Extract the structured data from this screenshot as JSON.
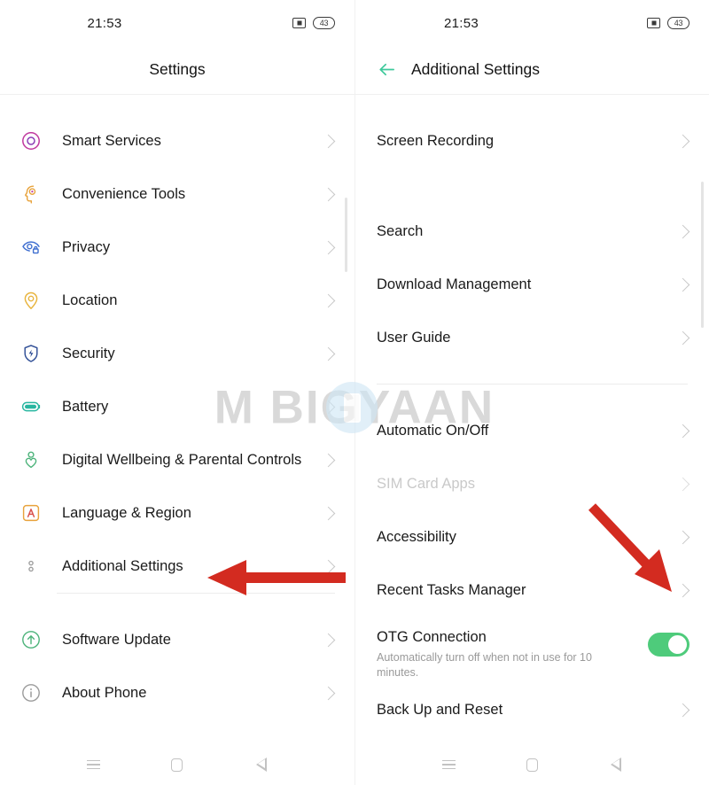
{
  "status": {
    "time": "21:53",
    "battery_level": "43",
    "cast_icon": "cast-icon",
    "battery_icon": "battery-icon"
  },
  "left_panel": {
    "title": "Settings",
    "items": [
      {
        "label": "Smart Services",
        "icon": "smart-services-icon",
        "color": "#c0399f"
      },
      {
        "label": "Convenience Tools",
        "icon": "convenience-tools-icon",
        "color": "#e8a33d"
      },
      {
        "label": "Privacy",
        "icon": "privacy-icon",
        "color": "#3f6fd0"
      },
      {
        "label": "Location",
        "icon": "location-icon",
        "color": "#e8b43d"
      },
      {
        "label": "Security",
        "icon": "security-icon",
        "color": "#2f4e96"
      },
      {
        "label": "Battery",
        "icon": "battery-settings-icon",
        "color": "#27b6a0"
      },
      {
        "label": "Digital Wellbeing & Parental Controls",
        "icon": "digital-wellbeing-icon",
        "color": "#4cb37a"
      },
      {
        "label": "Language & Region",
        "icon": "language-region-icon",
        "color": "#e8a33d"
      },
      {
        "label": "Additional Settings",
        "icon": "additional-settings-icon",
        "color": "#9b9b9b"
      },
      {
        "label": "Software Update",
        "icon": "software-update-icon",
        "color": "#4cb37a"
      },
      {
        "label": "About Phone",
        "icon": "about-phone-icon",
        "color": "#9b9b9b"
      }
    ]
  },
  "right_panel": {
    "title": "Additional Settings",
    "back_icon": "back-arrow-icon",
    "back_icon_color": "#3ec99b",
    "items": [
      {
        "label": "Screen Recording",
        "type": "link"
      },
      {
        "label": "Search",
        "type": "link"
      },
      {
        "label": "Download Management",
        "type": "link"
      },
      {
        "label": "User Guide",
        "type": "link"
      },
      {
        "label": "Automatic On/Off",
        "type": "link"
      },
      {
        "label": "SIM Card Apps",
        "type": "link",
        "state": "dimmed"
      },
      {
        "label": "Accessibility",
        "type": "link"
      },
      {
        "label": "Recent Tasks Manager",
        "type": "link"
      },
      {
        "label": "OTG Connection",
        "type": "toggle",
        "subtitle": "Automatically turn off when not in use for 10 minutes.",
        "toggle_on": true
      },
      {
        "label": "Back Up and Reset",
        "type": "link"
      }
    ]
  },
  "navbar": {
    "recents_icon": "recents-menu-icon",
    "home_icon": "home-square-icon",
    "back_icon": "back-triangle-icon"
  },
  "watermark": {
    "text": "M BIGYAAN",
    "phone_icon": "phone-watermark-icon"
  },
  "annotations": {
    "arrow_color": "#d32b20",
    "left_arrow": "arrow-pointing-to-additional-settings",
    "right_arrow": "arrow-pointing-to-otg-toggle"
  }
}
